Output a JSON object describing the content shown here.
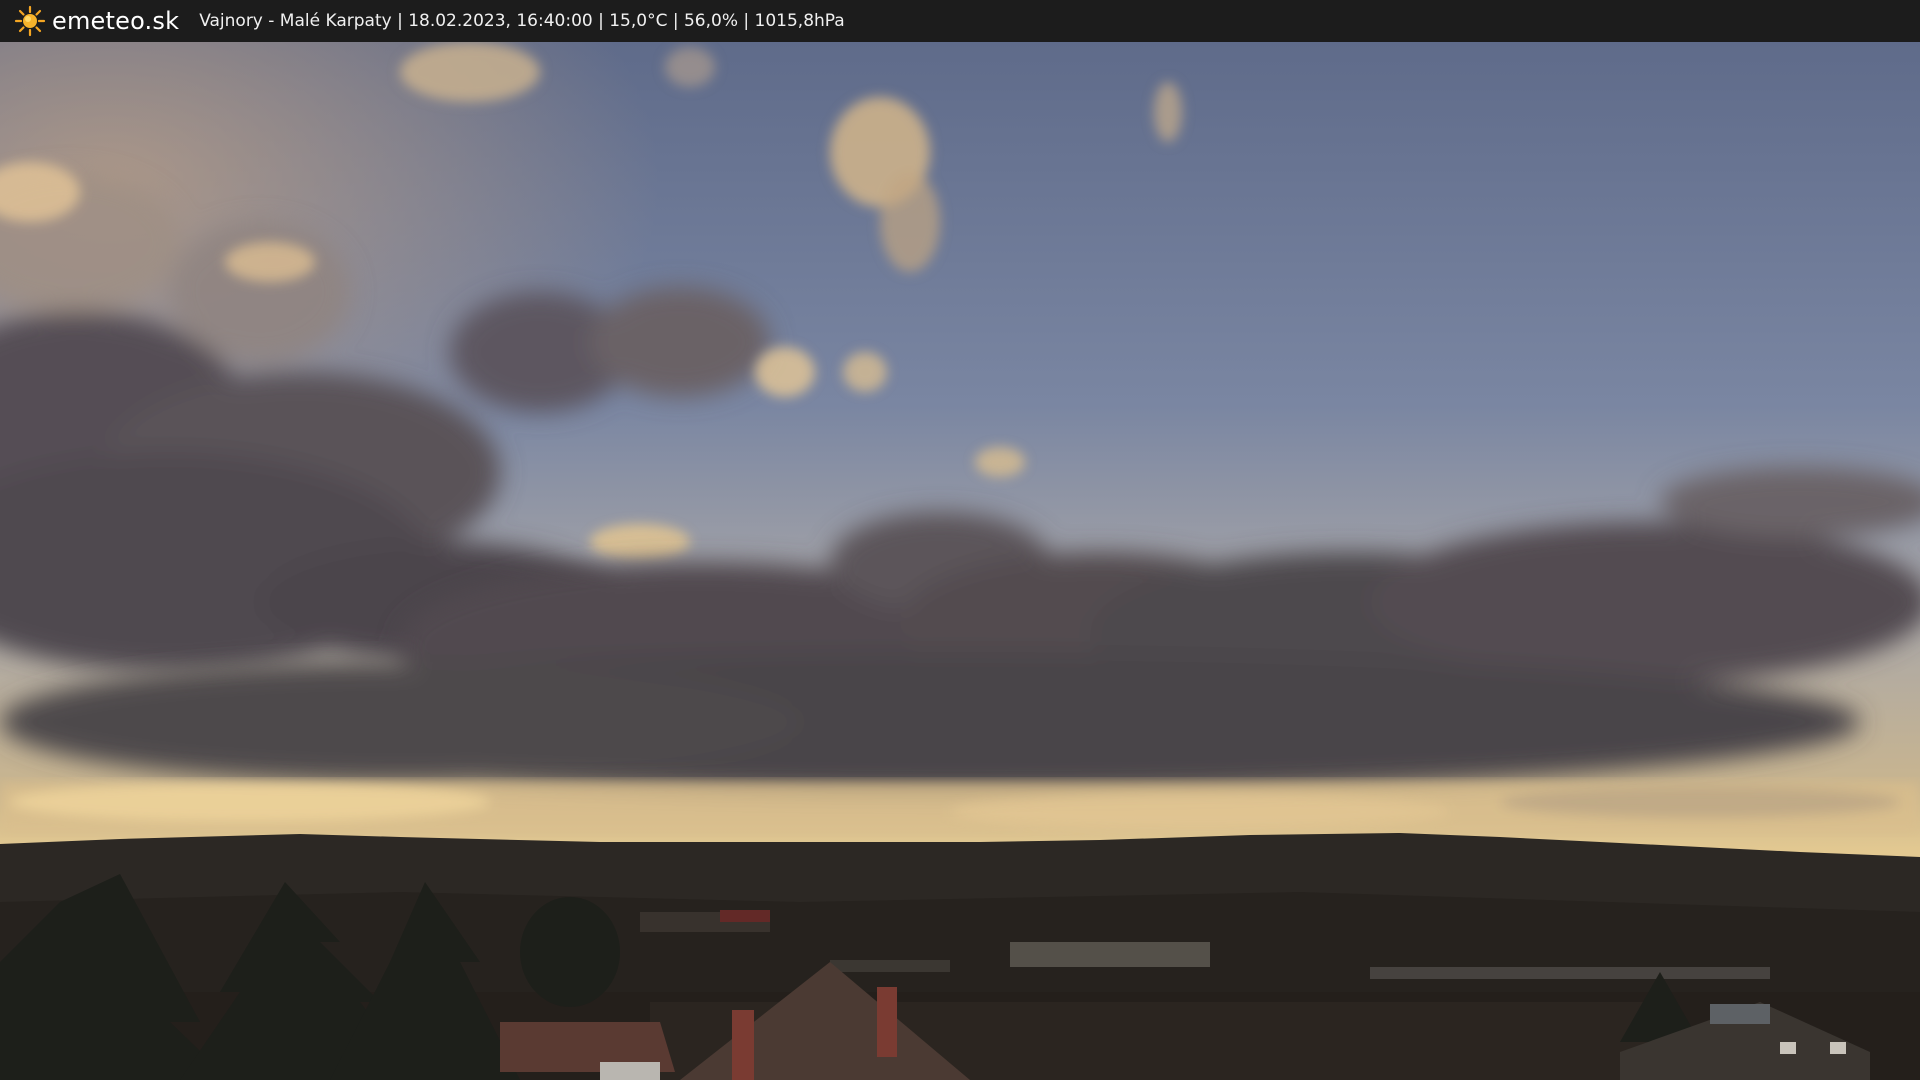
{
  "header": {
    "brand": "emeteo.sk",
    "caption": "Vajnory - Malé Karpaty | 18.02.2023, 16:40:00 | 15,0°C | 56,0% | 1015,8hPa",
    "logo_icon": "sun-icon",
    "colors": {
      "bar": "#1c1c1c",
      "sun": "#f5a623",
      "text": "#ffffff"
    }
  },
  "scene": {
    "description_colors": {
      "sky_top": "#5f6c8a",
      "sky_horizon": "#e2c98f",
      "clouds_dark": "#4a4550",
      "hills": "#2a2520",
      "foreground": "#1e1a16"
    }
  }
}
